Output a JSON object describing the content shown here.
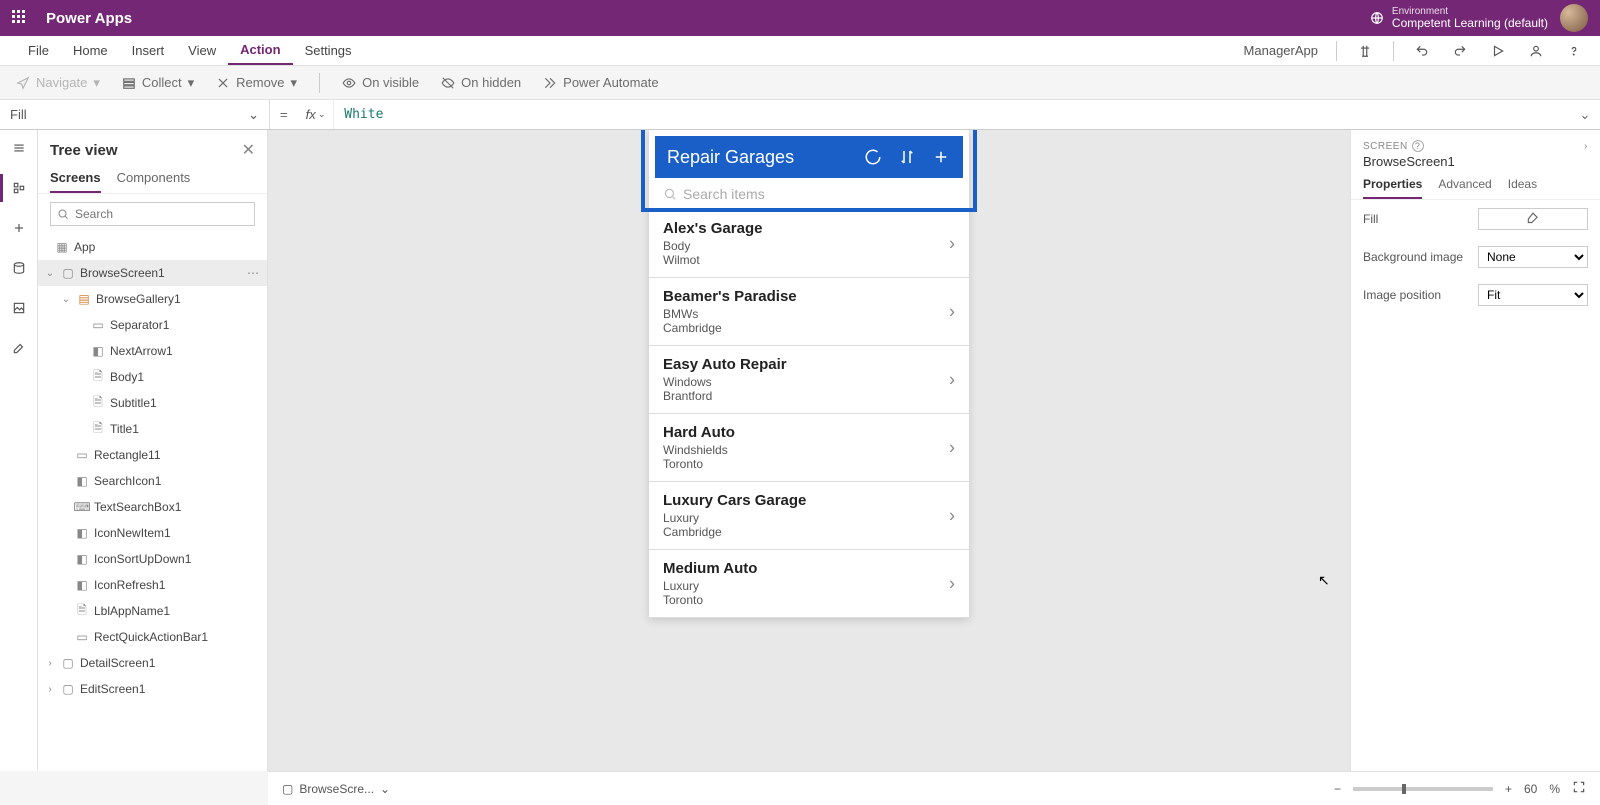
{
  "app_name": "Power Apps",
  "environment_label": "Environment",
  "environment_name": "Competent Learning (default)",
  "menus": {
    "file": "File",
    "home": "Home",
    "insert": "Insert",
    "view": "View",
    "action": "Action",
    "settings": "Settings"
  },
  "app_label_right": "ManagerApp",
  "action_toolbar": {
    "navigate": "Navigate",
    "collect": "Collect",
    "remove": "Remove",
    "on_visible": "On visible",
    "on_hidden": "On hidden",
    "power_automate": "Power Automate"
  },
  "formula": {
    "property": "Fill",
    "fx": "fx",
    "value": "White"
  },
  "tree": {
    "title": "Tree view",
    "tabs": {
      "screens": "Screens",
      "components": "Components"
    },
    "search_placeholder": "Search",
    "nodes": {
      "app": "App",
      "browse_screen": "BrowseScreen1",
      "browse_gallery": "BrowseGallery1",
      "separator": "Separator1",
      "next_arrow": "NextArrow1",
      "body": "Body1",
      "subtitle": "Subtitle1",
      "title": "Title1",
      "rectangle": "Rectangle11",
      "search_icon": "SearchIcon1",
      "text_search": "TextSearchBox1",
      "icon_new": "IconNewItem1",
      "icon_sort": "IconSortUpDown1",
      "icon_refresh": "IconRefresh1",
      "lbl_app_name": "LblAppName1",
      "rect_quick": "RectQuickActionBar1",
      "detail_screen": "DetailScreen1",
      "edit_screen": "EditScreen1"
    }
  },
  "phone": {
    "title": "Repair Garages",
    "search_placeholder": "Search items",
    "items": [
      {
        "title": "Alex's Garage",
        "subtitle": "Body",
        "body": "Wilmot"
      },
      {
        "title": "Beamer's Paradise",
        "subtitle": "BMWs",
        "body": "Cambridge"
      },
      {
        "title": "Easy Auto Repair",
        "subtitle": "Windows",
        "body": "Brantford"
      },
      {
        "title": "Hard Auto",
        "subtitle": "Windshields",
        "body": "Toronto"
      },
      {
        "title": "Luxury Cars Garage",
        "subtitle": "Luxury",
        "body": "Cambridge"
      },
      {
        "title": "Medium Auto",
        "subtitle": "Luxury",
        "body": "Toronto"
      }
    ]
  },
  "props": {
    "screen_label": "SCREEN",
    "object_name": "BrowseScreen1",
    "tabs": {
      "properties": "Properties",
      "advanced": "Advanced",
      "ideas": "Ideas"
    },
    "fill_label": "Fill",
    "bg_image_label": "Background image",
    "bg_image_value": "None",
    "img_pos_label": "Image position",
    "img_pos_value": "Fit"
  },
  "status": {
    "breadcrumb": "BrowseScre...",
    "zoom_pct": "60",
    "pct_sign": "%"
  }
}
